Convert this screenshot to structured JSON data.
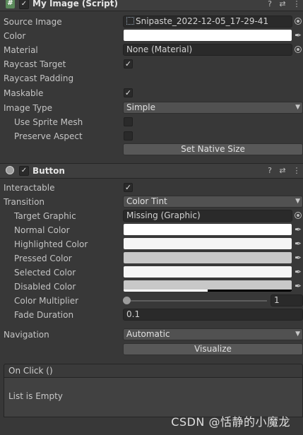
{
  "image_component": {
    "title": "My Image (Script)",
    "enabled_mark": "✓",
    "icons": [
      "help-icon",
      "presets-icon",
      "menu-icon"
    ],
    "fields": {
      "source_image_label": "Source Image",
      "source_image_value": "Snipaste_2022-12-05_17-29-41",
      "color_label": "Color",
      "material_label": "Material",
      "material_value": "None (Material)",
      "raycast_target_label": "Raycast Target",
      "raycast_target_mark": "✓",
      "raycast_padding_label": "Raycast Padding",
      "maskable_label": "Maskable",
      "maskable_mark": "✓",
      "image_type_label": "Image Type",
      "image_type_value": "Simple",
      "use_sprite_mesh_label": "Use Sprite Mesh",
      "preserve_aspect_label": "Preserve Aspect",
      "set_native_size_label": "Set Native Size"
    }
  },
  "button_component": {
    "title": "Button",
    "enabled_mark": "✓",
    "icons": [
      "help-icon",
      "presets-icon",
      "menu-icon"
    ],
    "fields": {
      "interactable_label": "Interactable",
      "interactable_mark": "✓",
      "transition_label": "Transition",
      "transition_value": "Color Tint",
      "target_graphic_label": "Target Graphic",
      "target_graphic_value": "Missing (Graphic)",
      "normal_color_label": "Normal Color",
      "highlighted_color_label": "Highlighted Color",
      "pressed_color_label": "Pressed Color",
      "selected_color_label": "Selected Color",
      "disabled_color_label": "Disabled Color",
      "color_multiplier_label": "Color Multiplier",
      "color_multiplier_value": "1",
      "fade_duration_label": "Fade Duration",
      "fade_duration_value": "0.1",
      "navigation_label": "Navigation",
      "navigation_value": "Automatic",
      "visualize_label": "Visualize"
    },
    "colors": {
      "normal": "#ffffff",
      "highlighted": "#f5f5f5",
      "pressed": "#c8c8c8",
      "selected": "#f5f5f5",
      "disabled": "#c8c8c8"
    },
    "disabled_alpha": 0.5,
    "color_multiplier_fraction": 0.0
  },
  "on_click": {
    "header": "On Click ()",
    "empty_text": "List is Empty"
  },
  "watermark": "CSDN @恬静的小魔龙"
}
